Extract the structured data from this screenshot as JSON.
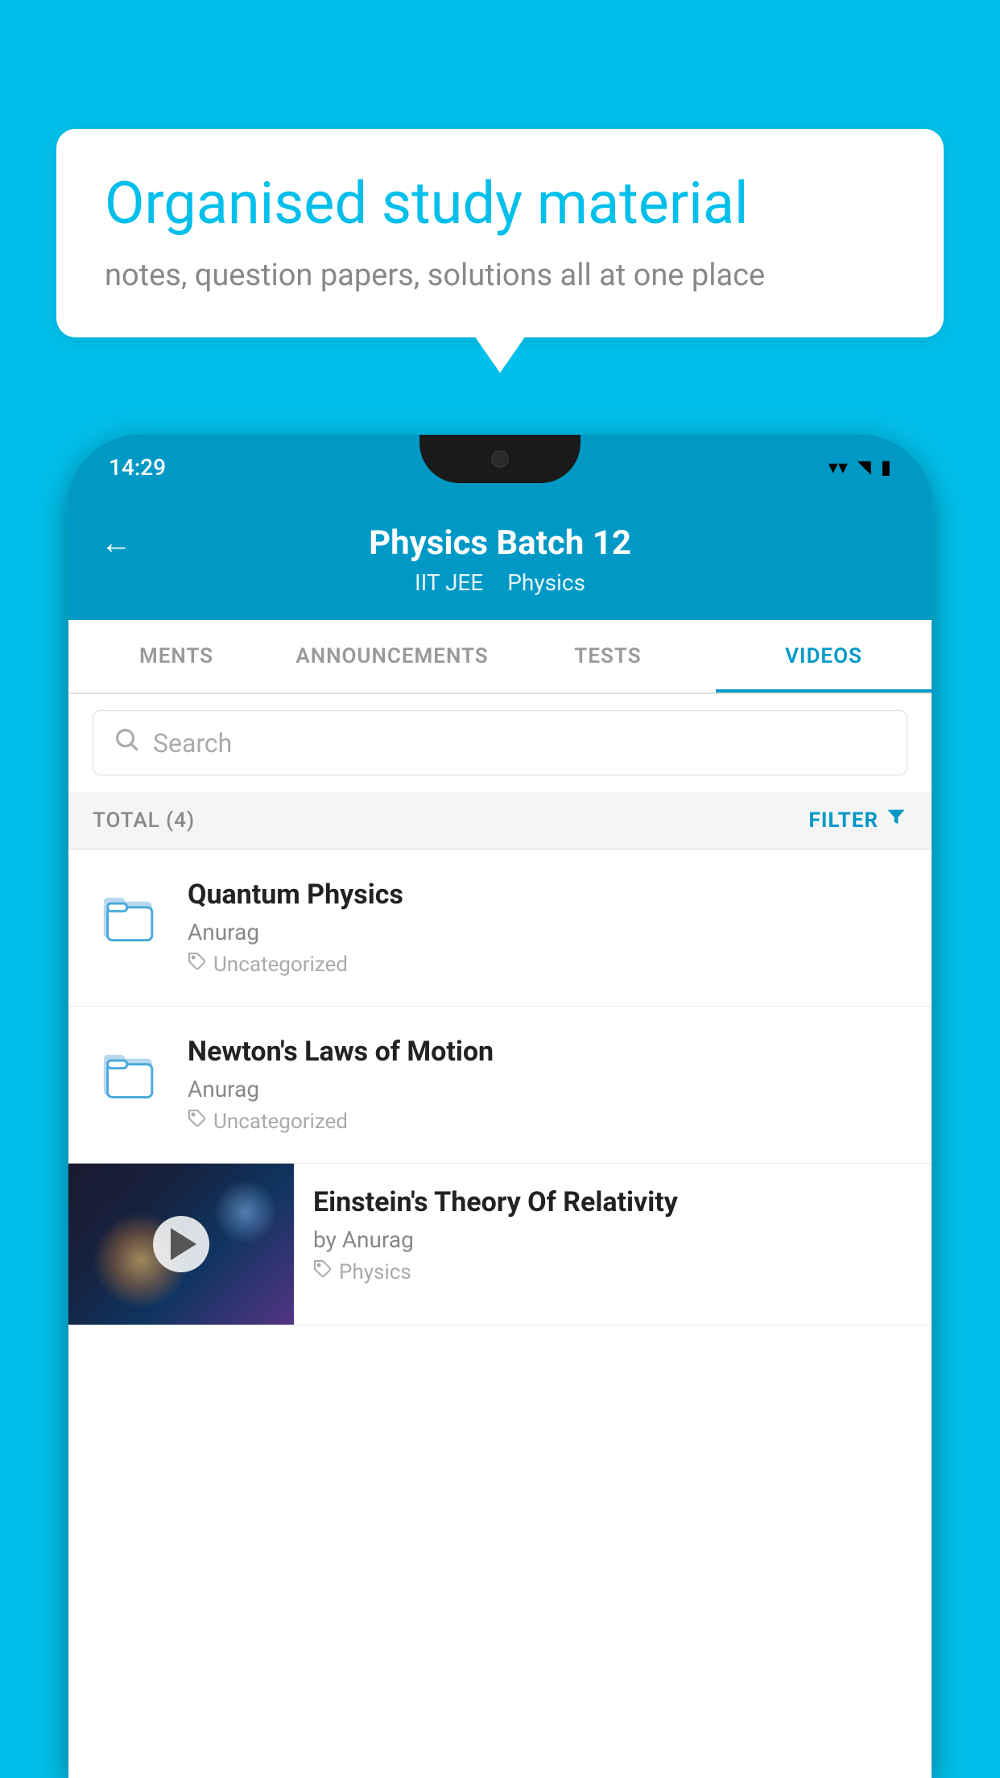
{
  "background_color": "#00BFEA",
  "speech_bubble": {
    "title": "Organised study material",
    "subtitle": "notes, question papers, solutions all at one place"
  },
  "status_bar": {
    "time": "14:29",
    "wifi": "▼",
    "signal": "▲",
    "battery": "▌"
  },
  "app_header": {
    "title": "Physics Batch 12",
    "subtitle_parts": [
      "IIT JEE",
      "Physics"
    ],
    "back_label": "←"
  },
  "tabs": [
    {
      "label": "MENTS",
      "active": false
    },
    {
      "label": "ANNOUNCEMENTS",
      "active": false
    },
    {
      "label": "TESTS",
      "active": false
    },
    {
      "label": "VIDEOS",
      "active": true
    }
  ],
  "search": {
    "placeholder": "Search"
  },
  "filter_bar": {
    "total_label": "TOTAL (4)",
    "filter_label": "FILTER"
  },
  "list_items": [
    {
      "title": "Quantum Physics",
      "author": "Anurag",
      "tag": "Uncategorized",
      "has_thumb": false
    },
    {
      "title": "Newton's Laws of Motion",
      "author": "Anurag",
      "tag": "Uncategorized",
      "has_thumb": false
    },
    {
      "title": "Einstein's Theory Of Relativity",
      "author": "by Anurag",
      "tag": "Physics",
      "has_thumb": true
    }
  ]
}
